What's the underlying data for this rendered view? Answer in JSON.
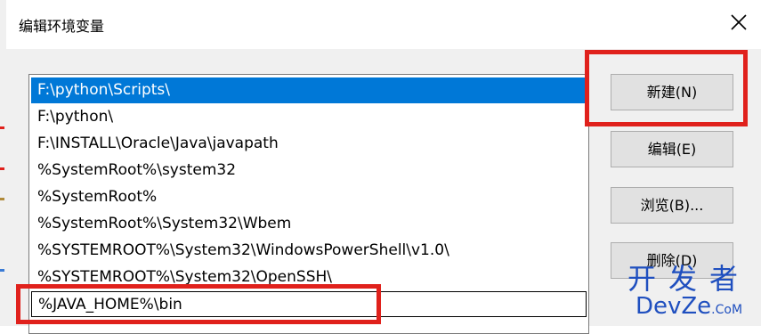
{
  "window": {
    "title": "编辑环境变量"
  },
  "list": {
    "items": [
      "F:\\python\\Scripts\\",
      "F:\\python\\",
      "F:\\INSTALL\\Oracle\\Java\\javapath",
      "%SystemRoot%\\system32",
      "%SystemRoot%",
      "%SystemRoot%\\System32\\Wbem",
      "%SYSTEMROOT%\\System32\\WindowsPowerShell\\v1.0\\",
      "%SYSTEMROOT%\\System32\\OpenSSH\\",
      "%JAVA_HOME%\\bin"
    ],
    "selected_index": 0,
    "editing_index": 8
  },
  "buttons": {
    "new": "新建(N)",
    "edit": "编辑(E)",
    "browse": "浏览(B)...",
    "delete": "删除(D)"
  },
  "watermark": {
    "cn": "开发者",
    "en_main": "DevZe",
    "en_tail": ".CoM"
  },
  "colors": {
    "selection": "#0078d7",
    "highlight": "#e0211c",
    "watermark": "#1f4fbf"
  }
}
